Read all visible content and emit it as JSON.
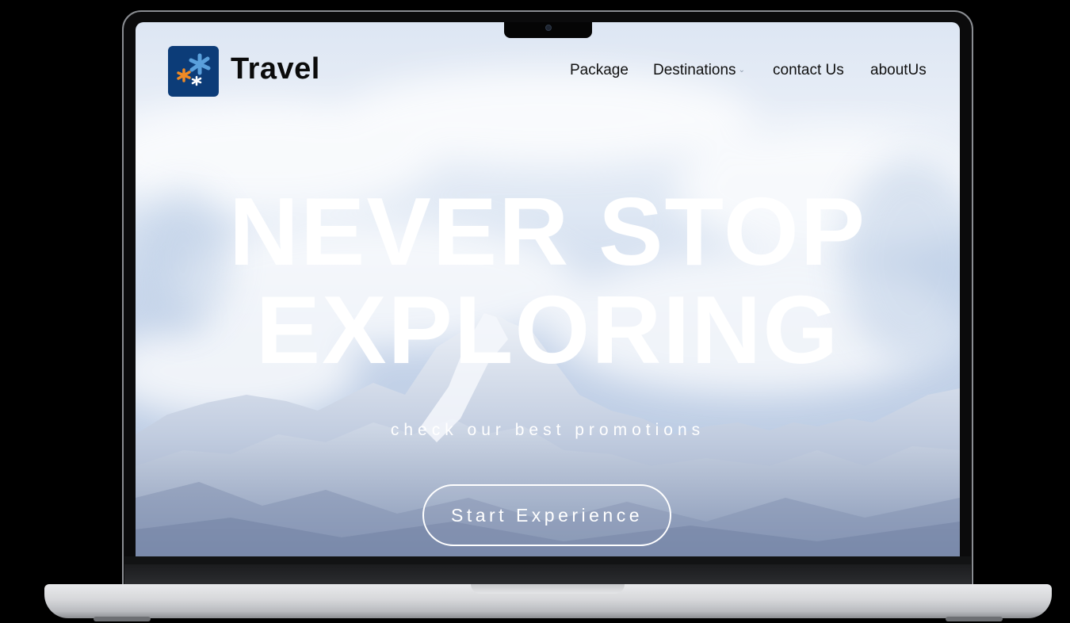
{
  "header": {
    "brand": "Travel",
    "logo_icon": "star-burst-logo-icon"
  },
  "nav": {
    "items": [
      {
        "label": "Package"
      },
      {
        "label": "Destinations",
        "icon": "chevron-down-icon"
      },
      {
        "label": "contact Us"
      },
      {
        "label": "aboutUs"
      }
    ]
  },
  "hero": {
    "title_line1": "NEVER STOP",
    "title_line2": "EXPLORING",
    "subtitle": "check our best promotions",
    "cta_label": "Start Experience"
  },
  "colors": {
    "logo_bg": "#0c3c78",
    "logo_blue": "#5aa0dc",
    "logo_orange": "#f08a24",
    "sky": "#dde6f3",
    "text_white": "#ffffff",
    "nav_text": "#111111"
  }
}
